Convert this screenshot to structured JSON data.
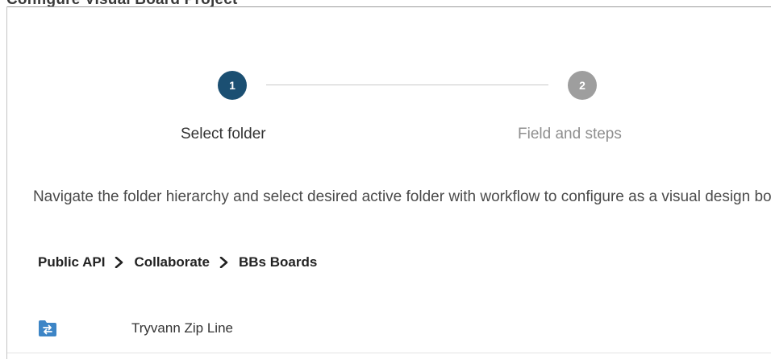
{
  "header": {
    "title": "Configure Visual Board Project"
  },
  "stepper": {
    "steps": [
      {
        "number": "1",
        "label": "Select folder"
      },
      {
        "number": "2",
        "label": "Field and steps"
      }
    ]
  },
  "description": "Navigate the folder hierarchy and select desired active folder with workflow to configure as a visual design board",
  "breadcrumb": {
    "items": [
      "Public API",
      "Collaborate",
      "BBs Boards"
    ]
  },
  "folders": [
    {
      "name": "Tryvann Zip Line",
      "icon": "workflow-folder-icon"
    }
  ],
  "colors": {
    "active_step": "#1b4f72",
    "inactive_step": "#9e9e9e",
    "folder_icon": "#3d85c6"
  }
}
